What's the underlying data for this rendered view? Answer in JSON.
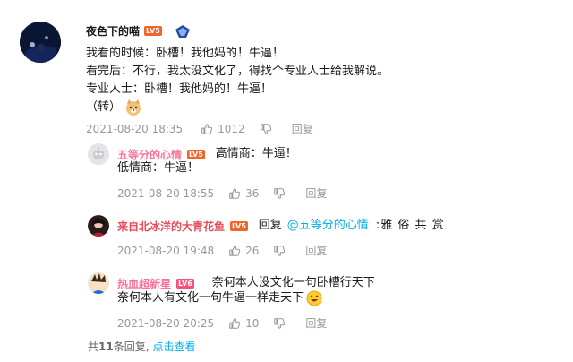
{
  "main_comment": {
    "username": "夜色下的喵",
    "level": "LV5",
    "lines": [
      "我看的时候：卧槽！我他妈的！牛逼！",
      "看完后：不行，我太没文化了，得找个专业人士给我解说。",
      "专业人士：卧槽！我他妈的！牛逼！",
      "（转）"
    ],
    "emoji": "doge",
    "time": "2021-08-20 18:35",
    "likes": "1012",
    "reply_label": "回复"
  },
  "replies": [
    {
      "username": "五等分的心情",
      "level": "LV5",
      "text_line1": "高情商：牛逼！",
      "text_line2": "低情商：牛逼！",
      "time": "2021-08-20 18:55",
      "likes": "36",
      "reply_label": "回复"
    },
    {
      "username": "来自北冰洋的大青花鱼",
      "level": "LV5",
      "reply_prefix": "回复",
      "mention": "@五等分的心情",
      "text": ":雅  俗  共  赏",
      "time": "2021-08-20 19:48",
      "likes": "26",
      "reply_label": "回复"
    },
    {
      "username": "热血超新星",
      "level": "LV6",
      "text_line1": "奈何本人没文化一句卧槽行天下",
      "text_line2": "奈何本人有文化一句牛逼一样走天下",
      "time": "2021-08-20 20:25",
      "likes": "10",
      "reply_label": "回复"
    }
  ],
  "footer": {
    "prefix": "共",
    "count": "11",
    "suffix": "条回复,",
    "link": "点击查看"
  },
  "colors": {
    "accent_blue": "#00aeec",
    "level_orange": "#f0652a",
    "level_pink": "#f8527b",
    "name_pink": "#fb7299",
    "name_red": "#e84a5a",
    "meta_gray": "#9499a0"
  }
}
